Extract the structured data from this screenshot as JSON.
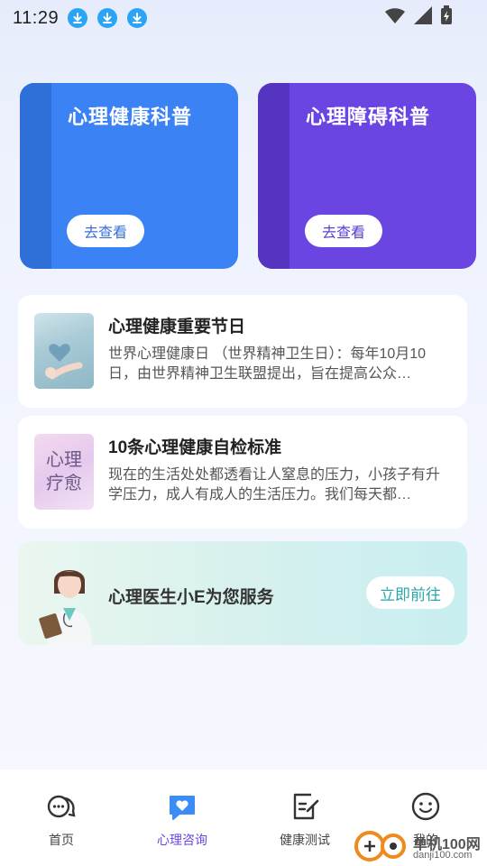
{
  "status_bar": {
    "time": "11:29",
    "download_icons": [
      "download-icon",
      "download-icon",
      "download-icon"
    ]
  },
  "cards": [
    {
      "title": "心理健康科普",
      "button": "去查看",
      "color": "#3b82f5"
    },
    {
      "title": "心理障碍科普",
      "button": "去查看",
      "color": "#6a45e2"
    }
  ],
  "articles": [
    {
      "title": "心理健康重要节日",
      "text": "世界心理健康日 （世界精神卫生日）：每年10月10日，由世界精神卫生联盟提出，旨在提高公众…"
    },
    {
      "title": "10条心理健康自检标准",
      "thumb_text": "心理\n疗愈",
      "text": "现在的生活处处都透看让人窒息的压力，小孩子有升学压力，成人有成人的生活压力。我们每天都…"
    }
  ],
  "doctor_banner": {
    "text": "心理医生小E为您服务",
    "button": "立即前往"
  },
  "tabs": [
    {
      "label": "首页",
      "icon": "chat-bubbles-icon"
    },
    {
      "label": "心理咨询",
      "icon": "heart-chat-icon",
      "active": true
    },
    {
      "label": "健康测试",
      "icon": "edit-document-icon"
    },
    {
      "label": "我的",
      "icon": "smile-face-icon"
    }
  ],
  "watermark": {
    "text": "单机100网",
    "sub": "danji100.com"
  },
  "colors": {
    "accent": "#6a45e2",
    "card_blue": "#3b82f5",
    "card_purple": "#6a45e2",
    "banner_button_text": "#2aa8a8"
  }
}
